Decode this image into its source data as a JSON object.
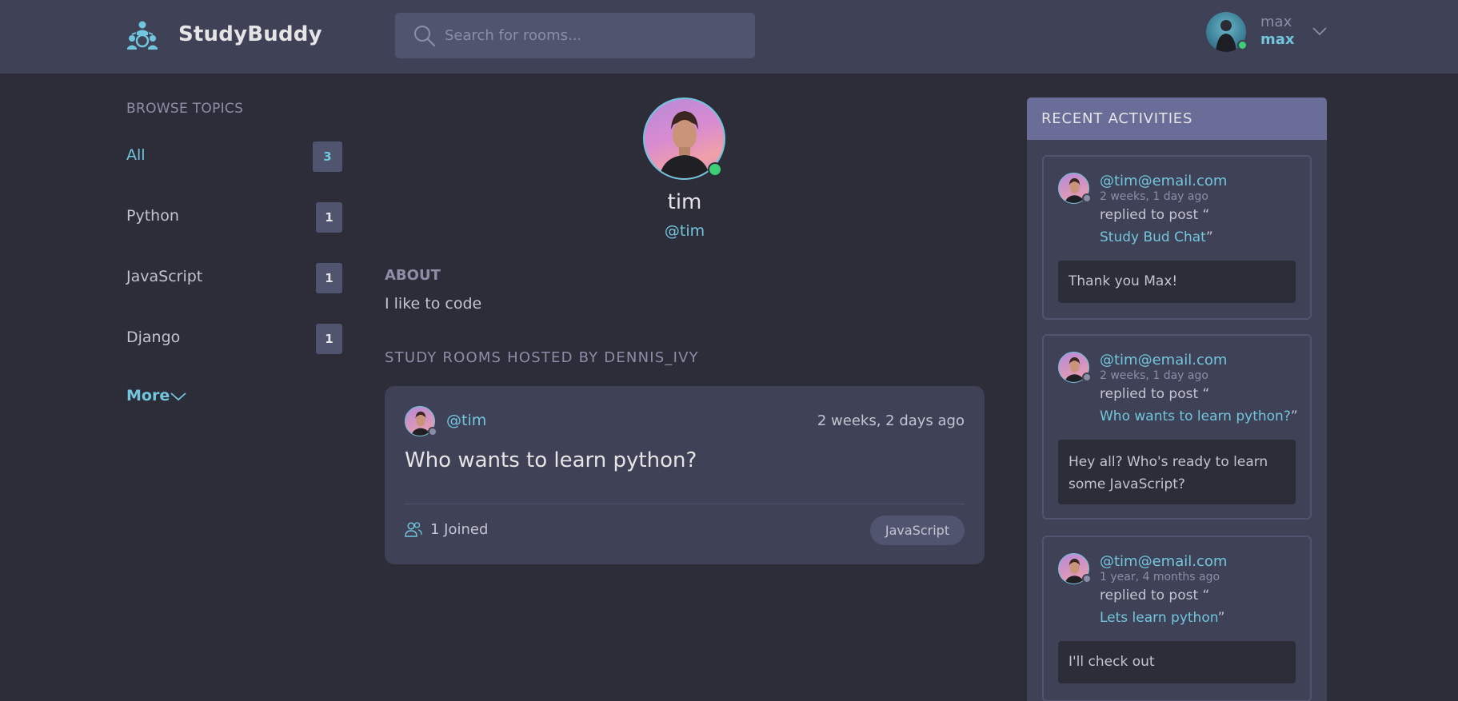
{
  "header": {
    "brand": "StudyBuddy",
    "search_placeholder": "Search for rooms...",
    "user": {
      "name": "max",
      "handle": "max",
      "status": "online"
    }
  },
  "sidebar": {
    "title": "BROWSE TOPICS",
    "topics": [
      {
        "label": "All",
        "count": "3",
        "active": true
      },
      {
        "label": "Python",
        "count": "1"
      },
      {
        "label": "JavaScript",
        "count": "1"
      },
      {
        "label": "Django",
        "count": "1"
      }
    ],
    "more_label": "More"
  },
  "profile": {
    "name": "tim",
    "handle": "@tim",
    "status": "online",
    "about_title": "ABOUT",
    "about_text": "I like to code",
    "rooms_title": "STUDY ROOMS HOSTED BY DENNIS_IVY"
  },
  "rooms": [
    {
      "host": "@tim",
      "time": "2 weeks, 2 days ago",
      "title": "Who wants to learn python?",
      "joined": "1 Joined",
      "topic": "JavaScript"
    }
  ],
  "activities": {
    "title": "RECENT ACTIVITIES",
    "items": [
      {
        "user": "@tim@email.com",
        "ago": "2 weeks, 1 day ago",
        "verb": "replied to post “",
        "post": "Study Bud Chat",
        "post_close": "”",
        "reply": "Thank you Max!"
      },
      {
        "user": "@tim@email.com",
        "ago": "2 weeks, 1 day ago",
        "verb": "replied to post “",
        "post": "Who wants to learn python?",
        "post_close": "”",
        "reply": "Hey all? Who's ready to learn some JavaScript?"
      },
      {
        "user": "@tim@email.com",
        "ago": "1 year, 4 months ago",
        "verb": "replied to post “",
        "post": "Lets learn python",
        "post_close": "”",
        "reply": "I'll check out"
      }
    ]
  },
  "colors": {
    "background": "#2d2d39",
    "panel": "#3f4156",
    "accent": "#71c6dd",
    "activity_header": "#696d97",
    "online": "#3ccf75"
  }
}
